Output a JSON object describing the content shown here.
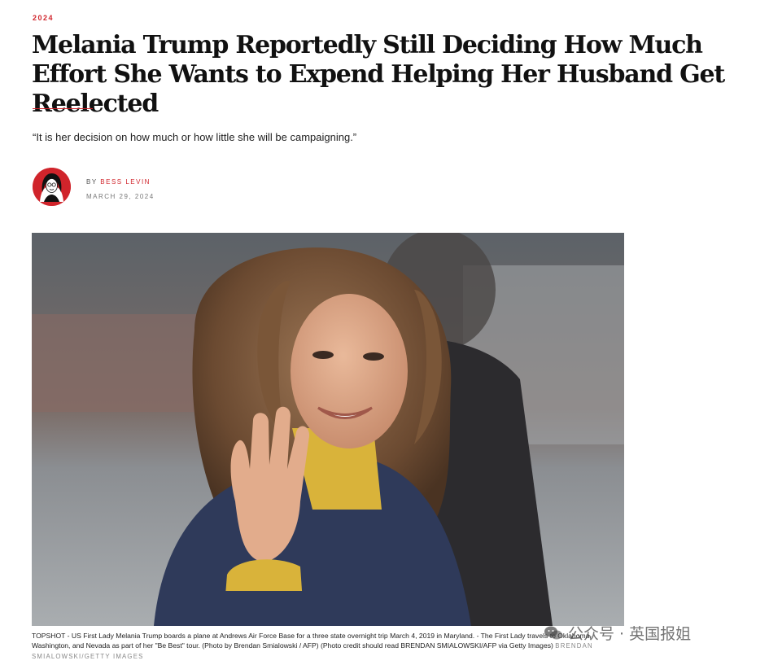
{
  "article": {
    "kicker": "2024",
    "headline": "Melania Trump Reportedly Still Deciding How Much Effort She Wants to Expend Helping Her Husband Get Reelected",
    "dek": "“It is her decision on how much or how little she will be campaigning.”",
    "byline_prefix": "BY",
    "author": "BESS LEVIN",
    "date": "MARCH 29, 2024",
    "caption": "TOPSHOT - US First Lady Melania Trump boards a plane at Andrews Air Force Base for a three state overnight trip March 4, 2019 in Maryland. - The First Lady travels to Oklahoma, Washington, and Nevada as part of her \"Be Best\" tour. (Photo by Brendan Smialowski / AFP) (Photo credit should read BRENDAN SMIALOWSKI/AFP via Getty Images)",
    "photo_credit": "BRENDAN SMIALOWSKI/GETTY IMAGES"
  },
  "watermark": {
    "text": "公众号 · 英国报姐",
    "icon": "wechat-icon"
  },
  "colors": {
    "accent": "#d0242b",
    "text": "#111111",
    "muted": "#777777"
  }
}
